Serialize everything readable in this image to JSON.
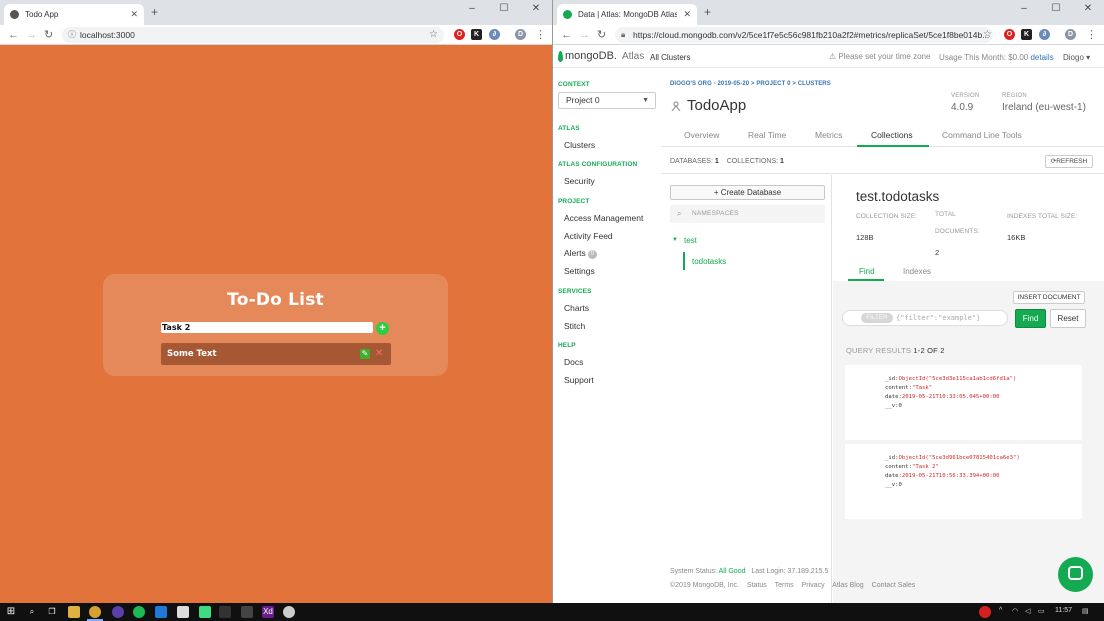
{
  "left_browser": {
    "tab_title": "Todo App",
    "url": "localhost:3000",
    "app": {
      "title": "To-Do List",
      "input_value": "Task 2",
      "add_label": "+",
      "items": [
        {
          "text": "Some Text"
        }
      ]
    }
  },
  "right_browser": {
    "tab_title": "Data | Atlas: MongoDB Atlas",
    "url": "https://cloud.mongodb.com/v2/5ce1f7e5c56c981fb210a2f2#metrics/replicaSet/5ce1f8be014b...",
    "header": {
      "logo_text": "mongoDB.",
      "logo_suffix": "Atlas",
      "all_clusters": "All Clusters",
      "timezone_notice": "Please set your time zone",
      "usage_label": "Usage This Month: $0.00",
      "usage_link": "details",
      "user": "Diogo"
    },
    "sidebar": {
      "context_heading": "CONTEXT",
      "project_select": "Project 0",
      "sections": [
        {
          "heading": "ATLAS",
          "items": [
            "Clusters"
          ]
        },
        {
          "heading": "ATLAS CONFIGURATION",
          "items": [
            "Security"
          ]
        },
        {
          "heading": "PROJECT",
          "items": [
            "Access Management",
            "Activity Feed",
            "Alerts",
            "Settings"
          ]
        },
        {
          "heading": "SERVICES",
          "items": [
            "Charts",
            "Stitch"
          ]
        },
        {
          "heading": "HELP",
          "items": [
            "Docs",
            "Support"
          ]
        }
      ],
      "alerts_badge": "0"
    },
    "main": {
      "breadcrumb": "DIOGO'S ORG - 2019-05-20 > PROJECT 0 > CLUSTERS",
      "cluster_name": "TodoApp",
      "version_label": "VERSION",
      "version_value": "4.0.9",
      "region_label": "REGION",
      "region_value": "Ireland (eu-west-1)",
      "tabs": [
        "Overview",
        "Real Time",
        "Metrics",
        "Collections",
        "Command Line Tools"
      ],
      "active_tab": "Collections",
      "databases_label": "DATABASES:",
      "databases_count": "1",
      "collections_label": "COLLECTIONS:",
      "collections_count": "1",
      "refresh_label": "REFRESH",
      "create_db_label": "+ Create Database",
      "namespaces_placeholder": "NAMESPACES",
      "database": "test",
      "collection": "todotasks",
      "panel": {
        "namespace": "test.todotasks",
        "collection_size_label": "COLLECTION SIZE:",
        "collection_size_value": "128B",
        "total_docs_label": "TOTAL DOCUMENTS:",
        "total_docs_value": "2",
        "indexes_size_label": "INDEXES TOTAL SIZE:",
        "indexes_size_value": "16KB",
        "subtabs": [
          "Find",
          "Indexes"
        ],
        "insert_label": "INSERT DOCUMENT",
        "filter_pill": "FILTER",
        "filter_placeholder": "{\"filter\":\"example\"}",
        "find_label": "Find",
        "reset_label": "Reset",
        "query_results_label": "QUERY RESULTS",
        "query_results_count": "1-2 OF 2",
        "documents": [
          {
            "id_key": "_id:",
            "id_value": "ObjectId(\"5ce3d3e115ca1ab1cd6fd1a\")",
            "content_key": "content:",
            "content_value": "\"Task\"",
            "date_key": "date:",
            "date_value": "2019-05-21T10:33:05.045+00:00",
            "v_key": "__v:",
            "v_value": "0"
          },
          {
            "id_key": "_id:",
            "id_value": "ObjectId(\"5ce3d961bce07815401ca6e3\")",
            "content_key": "content:",
            "content_value": "\"Task 2\"",
            "date_key": "date:",
            "date_value": "2019-05-21T10:56:33.394+00:00",
            "v_key": "__v:",
            "v_value": "0"
          }
        ]
      },
      "footer": {
        "status_label": "System Status:",
        "status_value": "All Good",
        "last_login": "Last Login: 37.189.215.5",
        "links": [
          "©2019 MongoDB, Inc.",
          "Status",
          "Terms",
          "Privacy",
          "Atlas Blog",
          "Contact Sales"
        ]
      }
    }
  },
  "taskbar": {
    "clock": "11:57"
  },
  "colors": {
    "todo_bg": "#e2733b",
    "atlas_green": "#13aa52",
    "link_blue": "#3574b7"
  }
}
